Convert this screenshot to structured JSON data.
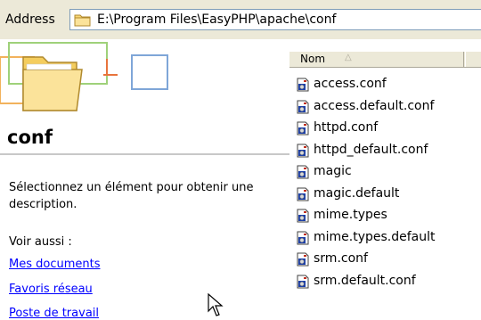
{
  "address_bar": {
    "label": "Address",
    "path": "E:\\Program Files\\EasyPHP\\apache\\conf",
    "icon": "folder-icon"
  },
  "task_pane": {
    "folder_title": "conf",
    "description": "Sélectionnez un élément pour obtenir une description.",
    "see_also_label": "Voir aussi :",
    "links": [
      "Mes documents",
      "Favoris réseau",
      "Poste de travail"
    ]
  },
  "file_list": {
    "column_header": "Nom",
    "sort_direction": "ascending",
    "file_icon": "config-file-icon",
    "files": [
      "access.conf",
      "access.default.conf",
      "httpd.conf",
      "httpd_default.conf",
      "magic",
      "magic.default",
      "mime.types",
      "mime.types.default",
      "srm.conf",
      "srm.default.conf"
    ]
  },
  "colors": {
    "chrome": "#ece9d8",
    "link": "#0000ff",
    "folder_yellow": "#f8d775"
  }
}
